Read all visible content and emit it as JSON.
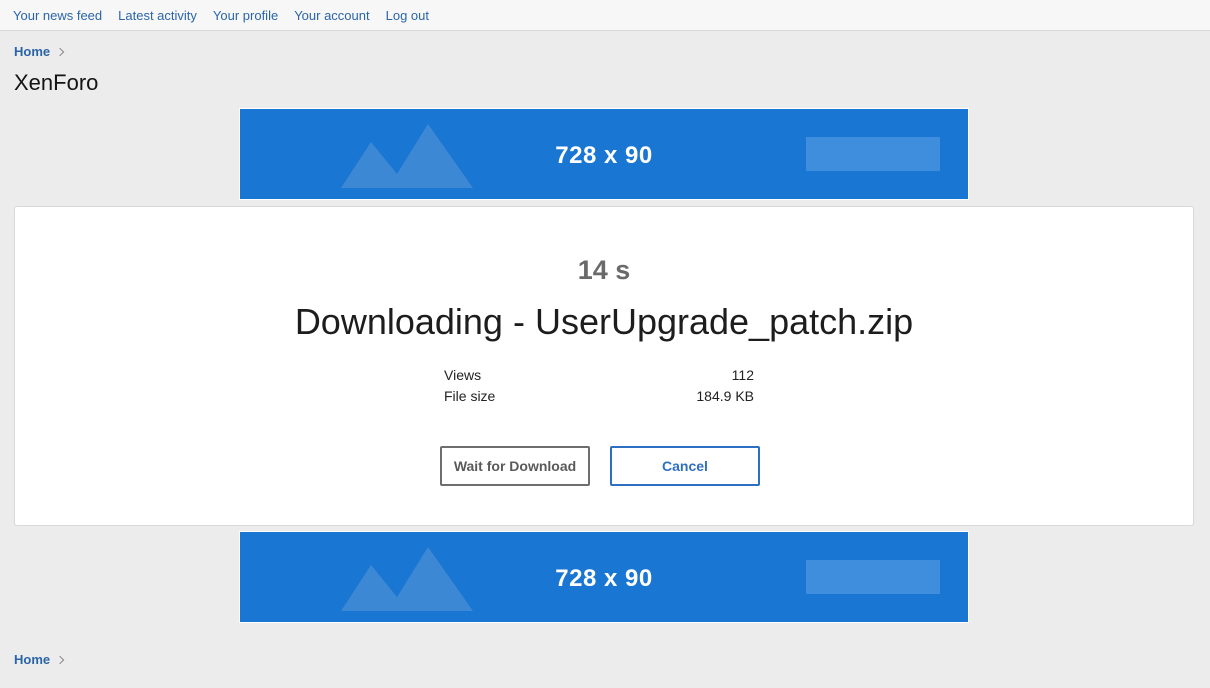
{
  "topnav": {
    "items": [
      "Your news feed",
      "Latest activity",
      "Your profile",
      "Your account",
      "Log out"
    ]
  },
  "breadcrumb": {
    "home": "Home"
  },
  "page": {
    "title": "XenForo"
  },
  "ads": {
    "top_label": "728 x 90",
    "bottom_label": "728 x 90"
  },
  "download": {
    "countdown": "14 s",
    "title": "Downloading - UserUpgrade_patch.zip",
    "info": [
      {
        "label": "Views",
        "value": "112"
      },
      {
        "label": "File size",
        "value": "184.9 KB"
      }
    ],
    "wait_button": "Wait for Download",
    "cancel_button": "Cancel"
  },
  "colors": {
    "link": "#2b65a8",
    "ad_background": "#1976d2",
    "cancel_accent": "#2f6fc3"
  },
  "icons": {
    "ad_graphic": "mountains-icon",
    "breadcrumb_separator": "chevron-right-icon"
  }
}
